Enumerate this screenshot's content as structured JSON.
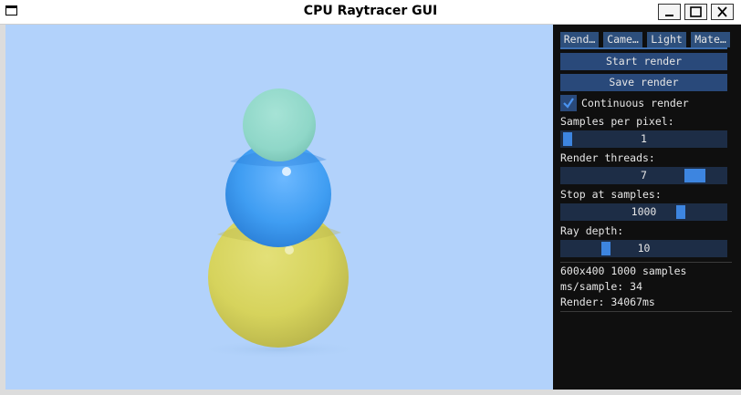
{
  "window": {
    "title": "CPU Raytracer GUI",
    "app_icon": "window-icon",
    "controls": [
      "minimize-icon",
      "maximize-icon",
      "close-icon"
    ]
  },
  "viewport": {
    "background": "#b2d2fb",
    "spheres": [
      {
        "name": "yellow",
        "color": "#d6d35c"
      },
      {
        "name": "blue",
        "color": "#3f9df2"
      },
      {
        "name": "teal",
        "color": "#8fd7c8"
      }
    ]
  },
  "panel": {
    "tabs": [
      {
        "label": "Rend…",
        "active": true
      },
      {
        "label": "Came…",
        "active": false
      },
      {
        "label": "Light",
        "active": false
      },
      {
        "label": "Mate…",
        "active": false
      }
    ],
    "start_render": "Start render",
    "save_render": "Save render",
    "continuous_render": {
      "label": "Continuous render",
      "checked": true
    },
    "samples_per_pixel": {
      "label": "Samples per pixel:",
      "value": "1",
      "min": 1,
      "max": 100
    },
    "render_threads": {
      "label": "Render threads:",
      "value": "7",
      "min": 1,
      "max": 8
    },
    "stop_at_samples": {
      "label": "Stop at samples:",
      "value": "1000",
      "min": 1,
      "max": 1500
    },
    "ray_depth": {
      "label": "Ray depth:",
      "value": "10",
      "min": 1,
      "max": 50
    },
    "stats": {
      "line1": "600x400 1000 samples",
      "line2": "ms/sample: 34",
      "line3": "Render: 34067ms"
    }
  },
  "colors": {
    "accent": "#3d85e0",
    "button": "#29497a",
    "tab": "#2d4f7c",
    "slider_bg": "#1d2d46",
    "panel_bg": "#0f0f0f"
  }
}
